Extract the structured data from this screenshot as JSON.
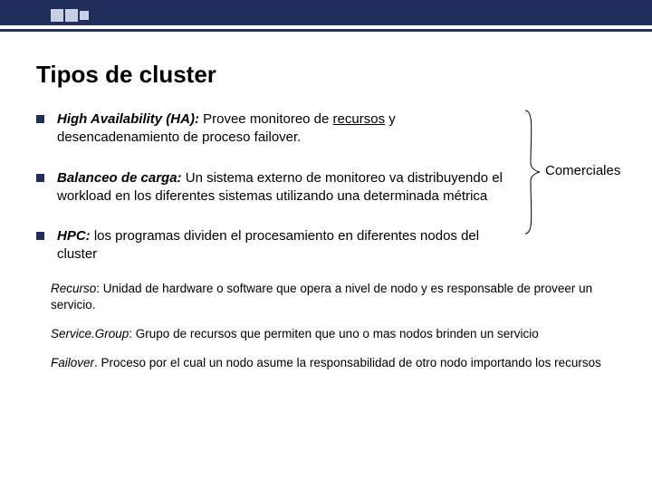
{
  "title": "Tipos de cluster",
  "bullets": {
    "b1": {
      "term": "High Availability (HA):",
      "rest1": " Provee monitoreo de ",
      "underlined": "recursos",
      "rest2": " y desencadenamiento de proceso failover."
    },
    "b2": {
      "term": "Balanceo de carga:",
      "rest": " Un sistema externo de monitoreo va distribuyendo el workload en los diferentes sistemas utilizando una determinada métrica"
    },
    "b3": {
      "term": "HPC:",
      "rest": " los programas dividen el procesamiento en diferentes nodos del cluster"
    }
  },
  "annotation": "Comerciales",
  "defs": {
    "d1": {
      "term": "Recurso",
      "rest": ": Unidad de hardware o software que opera a nivel de nodo y es responsable de proveer un servicio."
    },
    "d2": {
      "term": "Service.Group",
      "rest": ": Grupo de recursos que permiten que uno o mas nodos brinden un servicio"
    },
    "d3": {
      "term": "Failover",
      "rest": ". Proceso por el cual un nodo asume la responsabilidad de otro nodo importando los recursos"
    }
  }
}
